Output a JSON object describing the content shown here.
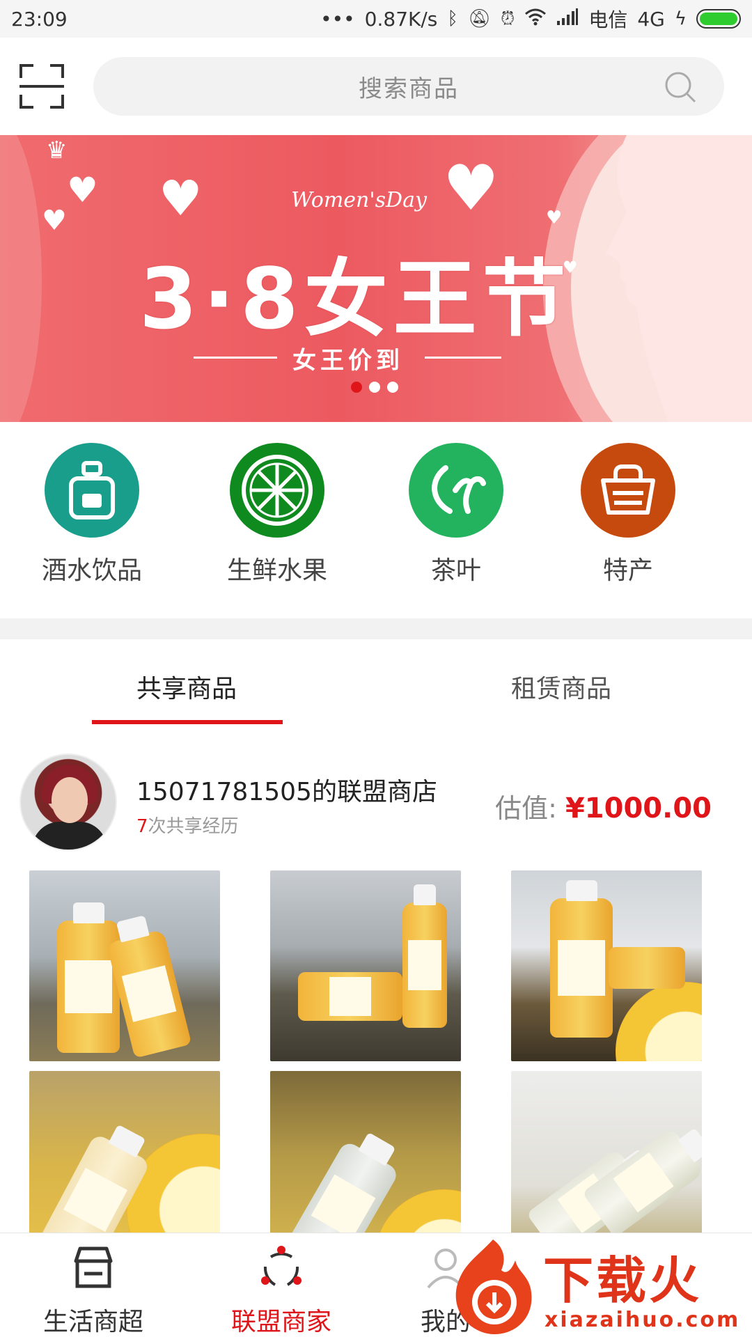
{
  "status_bar": {
    "time": "23:09",
    "dots": "•••",
    "speed": "0.87K/s",
    "carrier": "电信",
    "network": "4G"
  },
  "header": {
    "search_placeholder": "搜索商品"
  },
  "banner": {
    "script_text": "Women'sDay",
    "headline": "3·8女王节",
    "subtitle": "女王价到",
    "page_count": 3,
    "active_page": 1
  },
  "categories": [
    {
      "label": "酒水饮品",
      "color": "#1a9e8c",
      "icon": "bottle-icon"
    },
    {
      "label": "生鲜水果",
      "color": "#0f8a1f",
      "icon": "lime-slice-icon"
    },
    {
      "label": "茶叶",
      "color": "#23b35e",
      "icon": "tea-leaf-icon"
    },
    {
      "label": "特产",
      "color": "#c64a0e",
      "icon": "basket-icon"
    }
  ],
  "tabs": [
    {
      "label": "共享商品",
      "active": true
    },
    {
      "label": "租赁商品",
      "active": false
    }
  ],
  "shop": {
    "name": "15071781505的联盟商店",
    "share_count": "7",
    "share_suffix": "次共享经历",
    "value_label": "估值:",
    "value_amount": "¥1000.00"
  },
  "bottom_nav": [
    {
      "label": "生活商超",
      "icon": "store-icon",
      "active": false
    },
    {
      "label": "联盟商家",
      "icon": "share-network-icon",
      "active": true
    },
    {
      "label": "我的",
      "icon": "person-icon",
      "active": false
    }
  ],
  "watermark": {
    "text": "下载火",
    "url": "xiazaihuo.com"
  },
  "colors": {
    "accent": "#e0151a",
    "banner": "#ec5a60"
  }
}
